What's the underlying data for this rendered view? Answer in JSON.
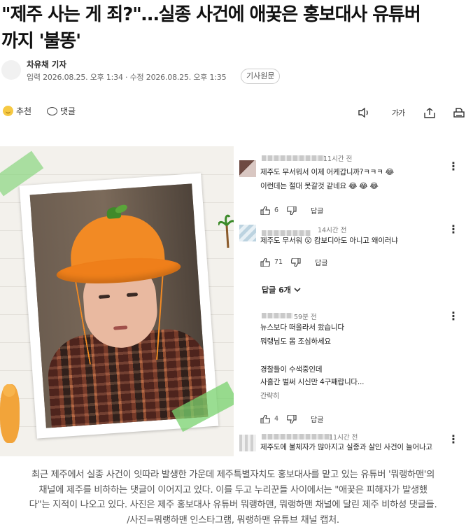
{
  "article": {
    "headline_line1": "\"제주 사는 게 죄?\"…실종 사건에 애꿎은 홍보대사 유튜버",
    "headline_line2": "까지 '불똥'",
    "reporter": "차유채 기자",
    "dates": "입력 2026.08.25. 오후 1:34 · 수정 2026.08.25. 오후 1:35",
    "original_button": "기사원문"
  },
  "actions": {
    "recommend_label": "추천",
    "comment_label": "댓글",
    "font_label": "가가"
  },
  "photo": {
    "comments": [
      {
        "time": "11시간 전",
        "lines": [
          "제주도 무서워서 이제 어케갑니까?ㅋㅋㅋ 😂",
          "이런데는 절대 못갈것 같네요 😂 😂 😂"
        ],
        "likes": "6",
        "reply": "답글"
      },
      {
        "time": "14시간 전",
        "lines": [
          "제주도 무서워 😮 캄보디아도 아니고 왜이러냐"
        ],
        "likes": "71",
        "reply": "답글"
      },
      {
        "time": "59분 전",
        "lines": [
          "뉴스보다 떠올라서 왔습니다",
          "뭐랭님도 몸 조심하세요",
          "",
          "경찰들이 수색중인데",
          "사흘간 벌써 시신만 4구째랍니다..."
        ],
        "more": "간략히",
        "likes": "4",
        "reply": "답글"
      },
      {
        "time": "11시간 전",
        "lines": [
          "제주도에 불체자가 많아지고 실종과 살인 사건이 늘어나고"
        ]
      }
    ],
    "replies_toggle": "답글 6개"
  },
  "caption": {
    "line1": "최근 제주에서 실종 사건이 잇따라 발생한 가운데 제주특별자치도 홍보대사를 맡고 있는 유튜버 '뭐랭하맨'의",
    "line2": "채널에 제주를 비하하는 댓글이 이어지고 있다. 이를 두고 누리꾼들 사이에서는 \"애꿎은 피해자가 발생했",
    "line3": "다\"는 지적이 나오고 있다. 사진은 제주 홍보대사 유튜버 뭐랭하맨, 뭐랭하맨 채널에 달린 제주 비하성 댓글들.",
    "line4": "/사진=뭐랭하맨 인스타그램, 뭐랭하맨 유튜브 채널 캡처."
  }
}
